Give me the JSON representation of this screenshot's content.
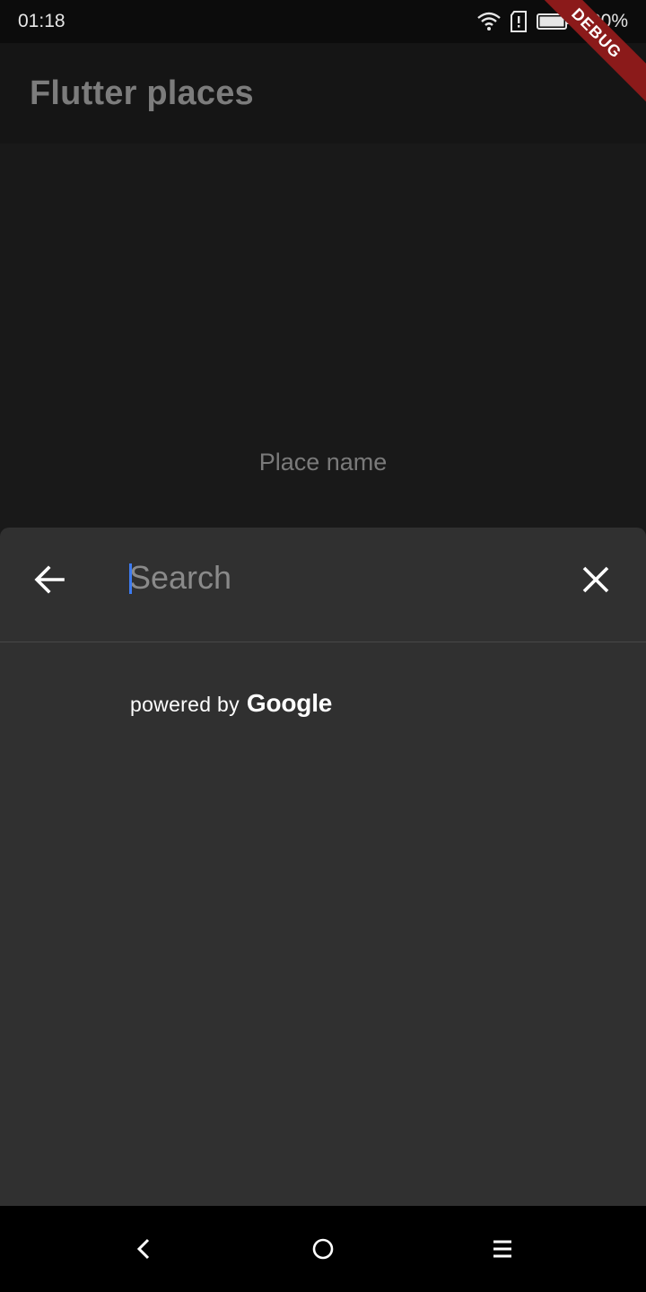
{
  "status_bar": {
    "time": "01:18",
    "battery": "100%"
  },
  "app_bar": {
    "title": "Flutter places"
  },
  "body": {
    "place_name": "Place name"
  },
  "search_sheet": {
    "placeholder": "Search",
    "powered_by": "powered by",
    "brand": "Google"
  },
  "debug_banner": "DEBUG",
  "colors": {
    "caret": "#3d7bf0",
    "debug": "#8b1a1a"
  }
}
